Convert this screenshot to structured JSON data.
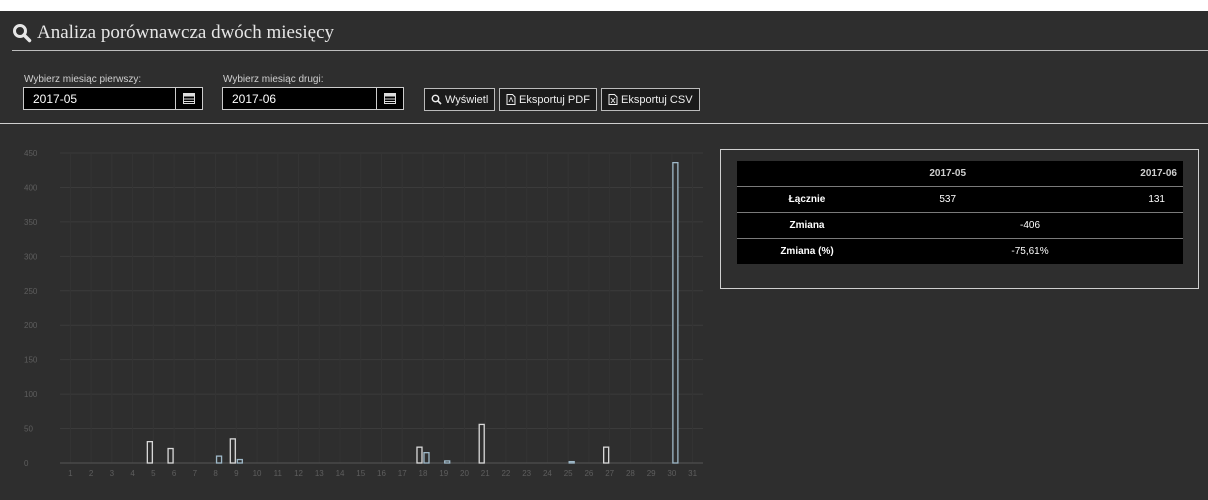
{
  "header": {
    "title": "Analiza porównawcza dwóch miesięcy",
    "icon": "search-icon"
  },
  "form": {
    "first_label": "Wybierz miesiąc pierwszy:",
    "first_value": "2017-05",
    "second_label": "Wybierz miesiąc drugi:",
    "second_value": "2017-06",
    "show_label": "Wyświetl",
    "pdf_label": "Eksportuj PDF",
    "csv_label": "Eksportuj CSV"
  },
  "summary": {
    "col1": "2017-05",
    "col2": "2017-06",
    "rows": [
      {
        "label": "Łącznie",
        "a": "537",
        "b": "131"
      },
      {
        "label": "Zmiana",
        "value": "-406"
      },
      {
        "label": "Zmiana (%)",
        "value": "-75,61%"
      }
    ]
  },
  "chart_data": {
    "type": "bar",
    "categories": [
      "1",
      "2",
      "3",
      "4",
      "5",
      "6",
      "7",
      "8",
      "9",
      "10",
      "11",
      "12",
      "13",
      "14",
      "15",
      "16",
      "17",
      "18",
      "19",
      "20",
      "21",
      "22",
      "23",
      "24",
      "25",
      "26",
      "27",
      "28",
      "29",
      "30",
      "31"
    ],
    "series": [
      {
        "color": "#d9d9d9",
        "values": [
          0,
          0,
          0,
          0,
          31,
          21,
          0,
          0,
          35,
          0,
          0,
          0,
          0,
          0,
          0,
          0,
          0,
          23,
          0,
          0,
          56,
          0,
          0,
          0,
          0,
          0,
          23,
          0,
          0,
          0,
          0
        ]
      },
      {
        "color": "#9fb9c9",
        "values": [
          0,
          0,
          0,
          0,
          0,
          0,
          0,
          10,
          5,
          0,
          0,
          0,
          0,
          0,
          0,
          0,
          0,
          15,
          3,
          0,
          0,
          0,
          0,
          0,
          2,
          0,
          0,
          0,
          0,
          436,
          0
        ]
      }
    ],
    "ylim": [
      0,
      450
    ],
    "yticks": [
      0,
      50,
      100,
      150,
      200,
      250,
      300,
      350,
      400,
      450
    ],
    "grid": true
  }
}
